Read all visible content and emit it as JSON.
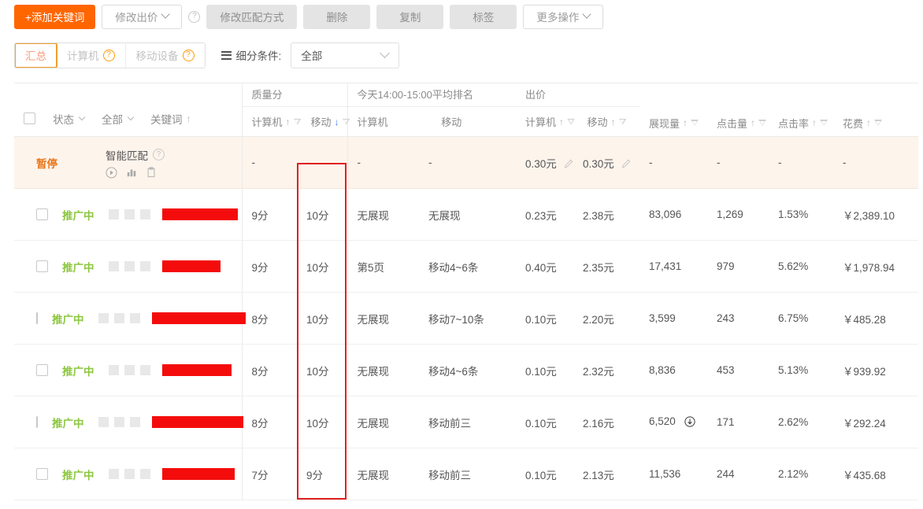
{
  "toolbar": {
    "buttons": [
      {
        "label": "+添加关键词",
        "style": "primary",
        "caret": false,
        "name": "add-keyword-button"
      },
      {
        "label": "修改出价",
        "style": "outline",
        "caret": true,
        "name": "modify-bid-button"
      },
      {
        "label": "修改匹配方式",
        "style": "gray",
        "caret": false,
        "name": "modify-match-type-button"
      },
      {
        "label": "删除",
        "style": "gray",
        "caret": false,
        "name": "delete-button"
      },
      {
        "label": "复制",
        "style": "gray",
        "caret": false,
        "name": "copy-button"
      },
      {
        "label": "标签",
        "style": "gray",
        "caret": false,
        "name": "tag-button"
      },
      {
        "label": "更多操作",
        "style": "outline",
        "caret": true,
        "name": "more-actions-button"
      }
    ],
    "help_icon": "question-mark-icon"
  },
  "filterbar": {
    "tabs": [
      {
        "label": "汇总",
        "active": true,
        "help": false
      },
      {
        "label": "计算机",
        "active": false,
        "help": true
      },
      {
        "label": "移动设备",
        "active": false,
        "help": true
      }
    ],
    "segment_label": "细分条件:",
    "segment_value": "全部",
    "list_icon": "list-icon",
    "chevron_icon": "chevron-down-icon"
  },
  "table": {
    "header": {
      "select_all": "select-all-checkbox",
      "status": "状态",
      "all": "全部",
      "keyword": "关键词",
      "keyword_sort": "↑",
      "groups": [
        {
          "title": "质量分",
          "subs": [
            {
              "label": "计算机",
              "sort": "↑",
              "sort_active": false,
              "filter": true
            },
            {
              "label": "移动",
              "sort": "↓",
              "sort_active": true,
              "filter": true
            }
          ]
        },
        {
          "title": "今天14:00-15:00平均排名",
          "subs": [
            {
              "label": "计算机",
              "sort": "",
              "sort_active": false,
              "filter": false
            },
            {
              "label": "移动",
              "sort": "",
              "sort_active": false,
              "filter": false
            }
          ]
        },
        {
          "title": "出价",
          "subs": [
            {
              "label": "计算机",
              "sort": "↑",
              "sort_active": false,
              "filter": true
            },
            {
              "label": "移动",
              "sort": "↑",
              "sort_active": false,
              "filter": true
            }
          ]
        }
      ],
      "metrics": [
        {
          "label": "展现量",
          "sort": "↑",
          "filter": true
        },
        {
          "label": "点击量",
          "sort": "↑",
          "filter": true
        },
        {
          "label": "点击率",
          "sort": "↑",
          "filter": true
        },
        {
          "label": "花费",
          "sort": "↑",
          "filter": true
        }
      ]
    },
    "summary_row": {
      "status": "暂停",
      "keyword": "智能匹配",
      "help_icon": "question-mark-icon",
      "action_icons": [
        "play-circle-icon",
        "bar-chart-icon",
        "clipboard-icon"
      ],
      "quality_pc": "-",
      "quality_mobile": "-",
      "rank_pc": "-",
      "rank_mobile": "-",
      "bid_pc": "0.30元",
      "bid_mobile": "0.30元",
      "edit_icon": "pencil-icon",
      "impressions": "-",
      "clicks": "-",
      "ctr": "-",
      "cost": "-"
    },
    "rows": [
      {
        "status": "推广中",
        "keyword_redacted_width": 96,
        "quality_pc": "9分",
        "quality_mobile": "10分",
        "rank_pc": "无展现",
        "rank_mobile": "无展现",
        "bid_pc": "0.23元",
        "bid_mobile": "2.38元",
        "impressions": "83,096",
        "impressions_trend": "",
        "clicks": "1,269",
        "ctr": "1.53%",
        "cost": "￥2,389.10"
      },
      {
        "status": "推广中",
        "keyword_redacted_width": 74,
        "quality_pc": "9分",
        "quality_mobile": "10分",
        "rank_pc": "第5页",
        "rank_mobile": "移动4~6条",
        "bid_pc": "0.40元",
        "bid_mobile": "2.35元",
        "impressions": "17,431",
        "impressions_trend": "",
        "clicks": "979",
        "ctr": "5.62%",
        "cost": "￥1,978.94"
      },
      {
        "status": "推广中",
        "keyword_redacted_width": 119,
        "quality_pc": "8分",
        "quality_mobile": "10分",
        "rank_pc": "无展现",
        "rank_mobile": "移动7~10条",
        "bid_pc": "0.10元",
        "bid_mobile": "2.20元",
        "impressions": "3,599",
        "impressions_trend": "",
        "clicks": "243",
        "ctr": "6.75%",
        "cost": "￥485.28"
      },
      {
        "status": "推广中",
        "keyword_redacted_width": 88,
        "quality_pc": "8分",
        "quality_mobile": "10分",
        "rank_pc": "无展现",
        "rank_mobile": "移动4~6条",
        "bid_pc": "0.10元",
        "bid_mobile": "2.32元",
        "impressions": "8,836",
        "impressions_trend": "",
        "clicks": "453",
        "ctr": "5.13%",
        "cost": "￥939.92"
      },
      {
        "status": "推广中",
        "keyword_redacted_width": 116,
        "quality_pc": "8分",
        "quality_mobile": "10分",
        "rank_pc": "无展现",
        "rank_mobile": "移动前三",
        "bid_pc": "0.10元",
        "bid_mobile": "2.16元",
        "impressions": "6,520",
        "impressions_trend": "down-circle-icon",
        "clicks": "171",
        "ctr": "2.62%",
        "cost": "￥292.24"
      },
      {
        "status": "推广中",
        "keyword_redacted_width": 92,
        "quality_pc": "7分",
        "quality_mobile": "9分",
        "rank_pc": "无展现",
        "rank_mobile": "移动前三",
        "bid_pc": "0.10元",
        "bid_mobile": "2.13元",
        "impressions": "11,536",
        "impressions_trend": "",
        "clicks": "244",
        "ctr": "2.12%",
        "cost": "￥435.68"
      }
    ]
  },
  "annotation": {
    "highlight_box": "red-highlight-rectangle",
    "highlight_color": "#e02020",
    "highlights_column": "质量分 / 移动"
  },
  "colors": {
    "primary": "#ff6600",
    "active_tab": "#f0a030",
    "status_on": "#8cc63e",
    "status_paused": "#e8761a",
    "redaction": "#f40c0c",
    "sort_active": "#3b82f6"
  }
}
